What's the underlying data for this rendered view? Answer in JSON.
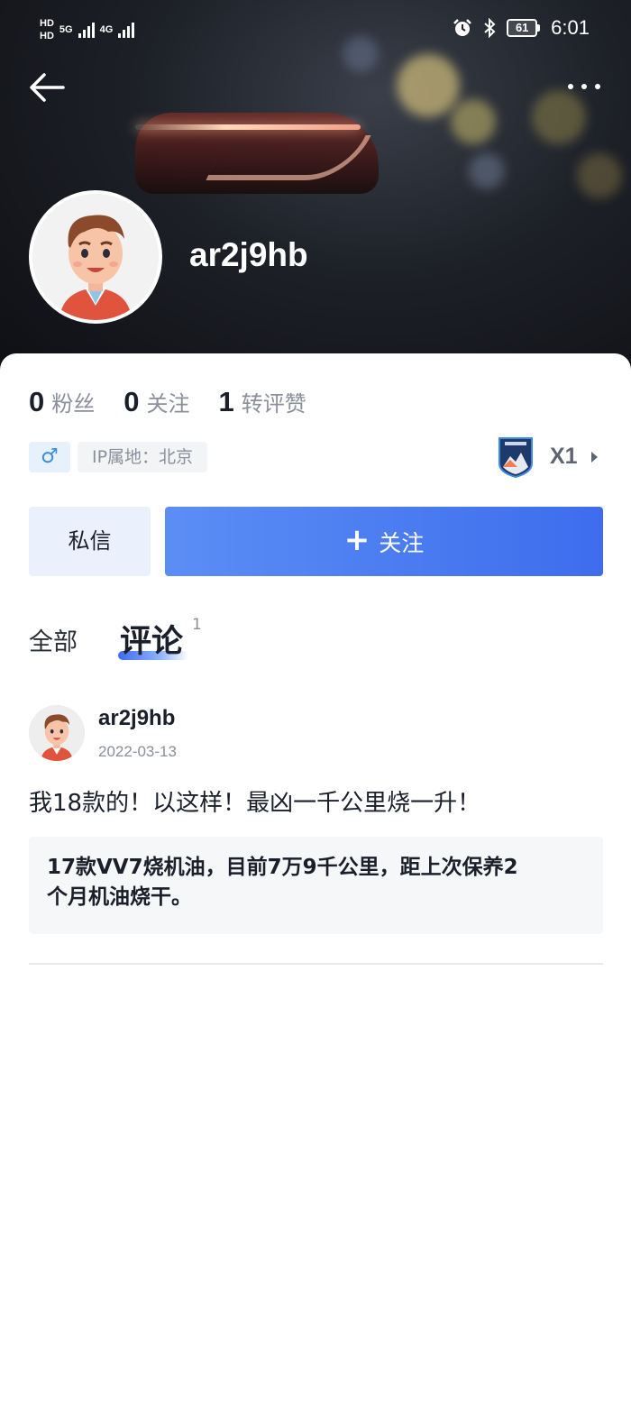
{
  "status_bar": {
    "net1": "HD",
    "net2": "HD",
    "gen1": "5G",
    "gen2": "4G",
    "battery": "61",
    "time": "6:01"
  },
  "profile": {
    "username": "ar2j9hb",
    "stats": [
      {
        "num": "0",
        "label": "粉丝"
      },
      {
        "num": "0",
        "label": "关注"
      },
      {
        "num": "1",
        "label": "转评赞"
      }
    ],
    "gender_symbol": "♂",
    "ip_location": "IP属地：北京",
    "level": "X1"
  },
  "actions": {
    "message_label": "私信",
    "follow_plus": "+",
    "follow_label": "关注"
  },
  "tabs": {
    "all_label": "全部",
    "comment_label": "评论",
    "comment_count": "1"
  },
  "feed": [
    {
      "author": "ar2j9hb",
      "date": "2022-03-13",
      "text": "我18款的！以这样！最凶一千公里烧一升！",
      "quote_line1": "17款VV7烧机油，目前7万9千公里，距上次保养2",
      "quote_line2": "个月机油烧干。"
    }
  ],
  "colors": {
    "accent": "#3d6ded",
    "accent_light": "#eaf1fd",
    "text_secondary": "#8a8f99",
    "gender_blue": "#3d8ae0"
  },
  "icons": {
    "back": "arrow-left-icon",
    "more": "more-dots-icon",
    "alarm": "alarm-icon",
    "bluetooth": "bluetooth-icon",
    "badge": "level-badge-icon"
  }
}
